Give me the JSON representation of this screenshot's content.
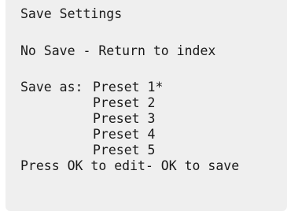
{
  "screen": {
    "title": "Save Settings",
    "no_save_option": "No Save - Return to index",
    "save_as_label": "Save as:",
    "presets": [
      {
        "label": "Preset 1*"
      },
      {
        "label": "Preset 2"
      },
      {
        "label": "Preset 3"
      },
      {
        "label": "Preset 4"
      },
      {
        "label": "Preset 5"
      }
    ],
    "footer_hint": "Press OK to edit- OK to save"
  }
}
